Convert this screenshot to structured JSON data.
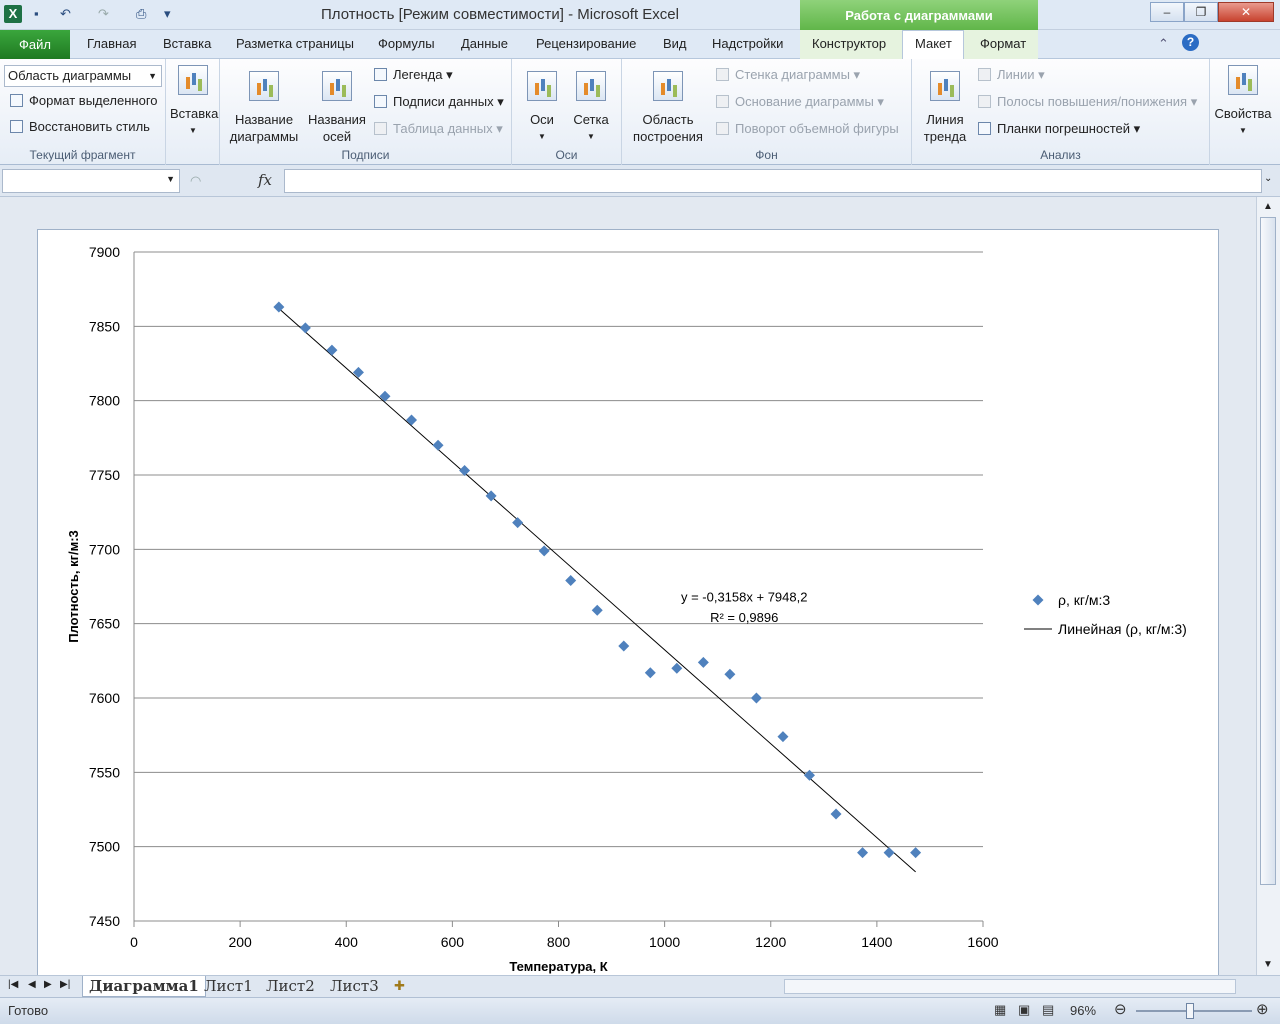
{
  "window": {
    "title": "Плотность  [Режим совместимости]  -  Microsoft Excel",
    "context_group": "Работа с диаграммами",
    "minimize": "‒",
    "restore": "❐",
    "close": "✕"
  },
  "tabs": {
    "file": "Файл",
    "home": "Главная",
    "insert": "Вставка",
    "page_layout": "Разметка страницы",
    "formulas": "Формулы",
    "data": "Данные",
    "review": "Рецензирование",
    "view": "Вид",
    "addins": "Надстройки",
    "design": "Конструктор",
    "layout": "Макет",
    "format": "Формат"
  },
  "ribbon": {
    "current_selection": {
      "combo_value": "Область диаграммы",
      "format_selection": "Формат выделенного",
      "reset_style": "Восстановить стиль",
      "label": "Текущий фрагмент"
    },
    "insert": {
      "label": "Вставка"
    },
    "labels_group": {
      "chart_title_1": "Название",
      "chart_title_2": "диаграммы",
      "axis_titles_1": "Названия",
      "axis_titles_2": "осей",
      "legend": "Легенда",
      "data_labels": "Подписи данных",
      "data_table": "Таблица данных",
      "label": "Подписи"
    },
    "axes_group": {
      "axes": "Оси",
      "gridlines": "Сетка",
      "label": "Оси"
    },
    "background_group": {
      "plot_area_1": "Область",
      "plot_area_2": "построения",
      "chart_wall": "Стенка диаграммы",
      "chart_floor": "Основание диаграммы",
      "rotation_3d": "Поворот объемной фигуры",
      "label": "Фон"
    },
    "analysis_group": {
      "trendline_1": "Линия",
      "trendline_2": "тренда",
      "lines": "Линии",
      "updown_bars": "Полосы повышения/понижения",
      "error_bars": "Планки погрешностей",
      "label": "Анализ"
    },
    "properties": {
      "label": "Свойства"
    }
  },
  "formula_bar": {
    "fx": "fx"
  },
  "sheet_tabs": [
    "Диаграмма1",
    "Лист1",
    "Лист2",
    "Лист3"
  ],
  "status": {
    "ready": "Готово",
    "zoom": "96%"
  },
  "chart_data": {
    "type": "scatter",
    "xlabel": "Температура, К",
    "ylabel": "Плотность, кг/м:3",
    "xlim": [
      0,
      1600
    ],
    "ylim": [
      7450,
      7900
    ],
    "xticks": [
      "0",
      "200",
      "400",
      "600",
      "800",
      "1000",
      "1200",
      "1400",
      "1600"
    ],
    "yticks": [
      "7900",
      "7850",
      "7800",
      "7750",
      "7700",
      "7650",
      "7600",
      "7550",
      "7500",
      "7450"
    ],
    "grid": "horizontal",
    "legend_position": "right",
    "series": [
      {
        "name": "ρ, кг/м:3",
        "color": "#4f81bd",
        "marker": "diamond",
        "x": [
          273,
          323,
          373,
          423,
          473,
          523,
          573,
          623,
          673,
          723,
          773,
          823,
          873,
          923,
          973,
          1023,
          1073,
          1123,
          1173,
          1223,
          1273,
          1323,
          1373,
          1423,
          1473
        ],
        "y": [
          7863,
          7849,
          7834,
          7819,
          7803,
          7787,
          7770,
          7753,
          7736,
          7718,
          7699,
          7679,
          7659,
          7635,
          7617,
          7620,
          7624,
          7616,
          7600,
          7574,
          7548,
          7522,
          7496,
          7496,
          7496
        ]
      }
    ],
    "trendline": {
      "name": "Линейная (ρ, кг/м:3)",
      "type": "linear",
      "slope": -0.3158,
      "intercept": 7948.2,
      "x_range": [
        273,
        1473
      ],
      "equation": "y = -0,3158x + 7948,2",
      "r2": "R² = 0,9896"
    }
  }
}
